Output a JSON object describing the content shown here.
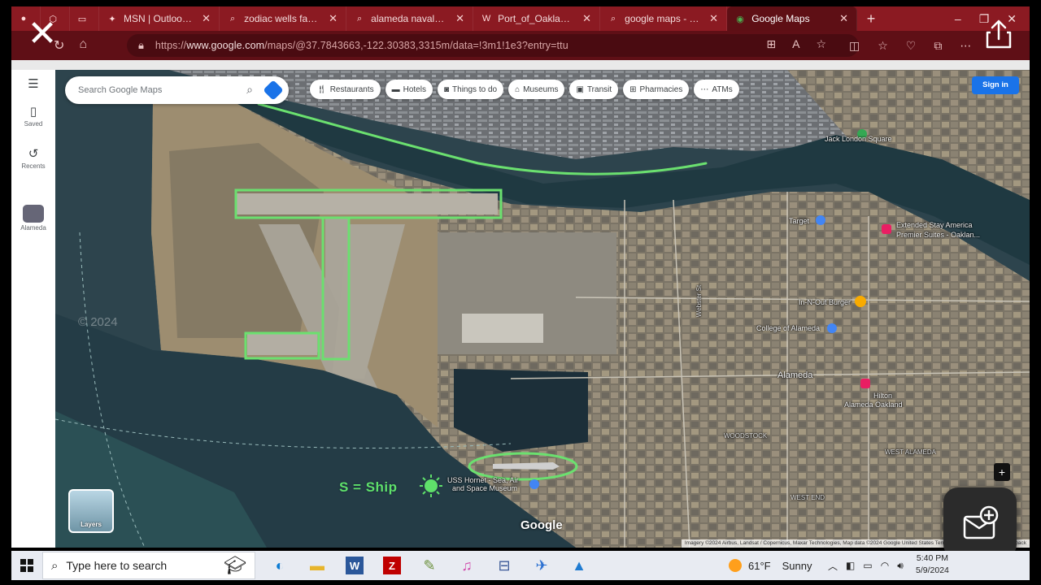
{
  "browser": {
    "tabs": [
      {
        "title": "",
        "icon": "app-icon"
      },
      {
        "title": "",
        "icon": "extension-icon"
      },
      {
        "title": "",
        "icon": "tab-actions-icon"
      },
      {
        "title": "MSN | Outlook, Offi",
        "icon": "msn-icon"
      },
      {
        "title": "zodiac wells fargo l",
        "icon": "search-icon"
      },
      {
        "title": "alameda naval air st",
        "icon": "search-icon"
      },
      {
        "title": "Port_of_Oakland_ar",
        "icon": "wikipedia-icon"
      },
      {
        "title": "google maps - Sea",
        "icon": "search-icon"
      },
      {
        "title": "Google Maps",
        "icon": "google-maps-icon",
        "active": true
      }
    ],
    "url_prefix": "https://",
    "url_domain": "www.google.com",
    "url_path": "/maps/@37.7843663,-122.30383,3315m/data=!3m1!1e3?entry=ttu"
  },
  "maps": {
    "search_placeholder": "Search Google Maps",
    "rail": [
      {
        "label": "Saved",
        "icon": "bookmark-icon"
      },
      {
        "label": "Recents",
        "icon": "history-icon"
      },
      {
        "label": "Alameda",
        "icon": "place-thumbnail-icon"
      }
    ],
    "chips": [
      {
        "label": "Restaurants",
        "icon": "fork-knife-icon"
      },
      {
        "label": "Hotels",
        "icon": "bed-icon"
      },
      {
        "label": "Things to do",
        "icon": "camera-icon"
      },
      {
        "label": "Museums",
        "icon": "museum-icon"
      },
      {
        "label": "Transit",
        "icon": "bus-icon"
      },
      {
        "label": "Pharmacies",
        "icon": "pharmacy-icon"
      },
      {
        "label": "ATMs",
        "icon": "more-icon"
      }
    ],
    "signin": "Sign in",
    "layers_label": "Layers",
    "google_logo": "Google",
    "attribution": "Imagery ©2024 Airbus, Landsat / Copernicus, Maxar Technologies, Map data ©2024 Google   United States   Terms   Privacy   Send Product Feedback",
    "labels": {
      "jack_london": "Jack London Square",
      "extended_stay_1": "Extended Stay America",
      "extended_stay_2": "Premier Suites - Oaklan...",
      "target": "Target",
      "in_n_out": "In-N-Out Burger",
      "college": "College of Alameda",
      "alameda": "Alameda",
      "hilton_1": "Hilton",
      "hilton_2": "Alameda Oakland",
      "woodstock": "WOODSTOCK",
      "west_alameda": "WEST ALAMEDA",
      "west_end": "WEST END",
      "hornet_1": "USS Hornet - Sea, Air",
      "hornet_2": "and Space Museum",
      "webster": "Webster St",
      "watermark": "© 2024"
    },
    "annotation": "S = Ship"
  },
  "taskbar": {
    "search_placeholder": "Type here to search",
    "apps": [
      {
        "name": "edge-icon"
      },
      {
        "name": "file-explorer-icon"
      },
      {
        "name": "word-icon"
      },
      {
        "name": "filezilla-icon"
      },
      {
        "name": "paint-icon"
      },
      {
        "name": "itunes-icon"
      },
      {
        "name": "network-icon"
      },
      {
        "name": "airplane-app-icon"
      },
      {
        "name": "photos-icon"
      }
    ],
    "weather_temp": "61°F",
    "weather_desc": "Sunny",
    "time": "5:40 PM",
    "date": "5/9/2024"
  },
  "colors": {
    "browser_red": "#8b1a22",
    "annotation_green": "#5fe06a",
    "maps_blue": "#1a73e8"
  }
}
